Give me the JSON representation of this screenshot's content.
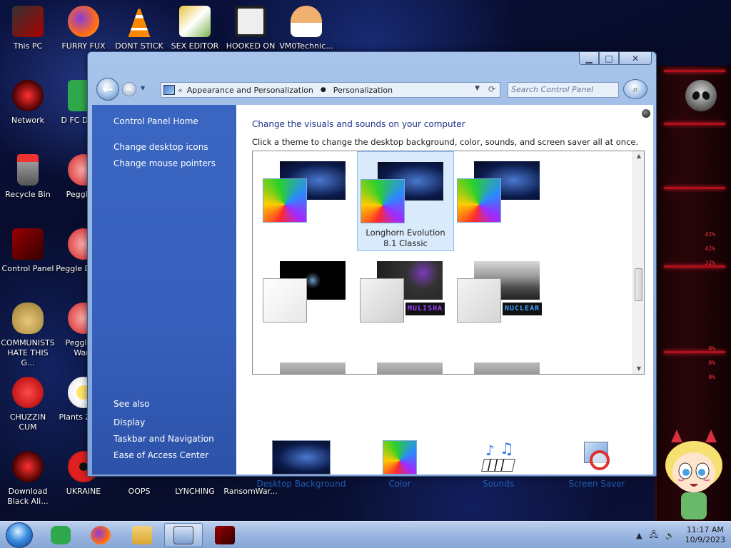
{
  "desktop": {
    "icons": [
      {
        "label": "This PC"
      },
      {
        "label": "FURRY FUX"
      },
      {
        "label": "DONT STICK"
      },
      {
        "label": "SEX EDITOR"
      },
      {
        "label": "HOOKED ON"
      },
      {
        "label": "VM0Technic..."
      },
      {
        "label": "Network"
      },
      {
        "label": "D FC DUMB"
      },
      {
        "label": "Recycle Bin"
      },
      {
        "label": "Peggle D"
      },
      {
        "label": "Control Panel"
      },
      {
        "label": "Peggle D Delu"
      },
      {
        "label": "COMMUNISTS HATE THIS G..."
      },
      {
        "label": "Peggle of Warc"
      },
      {
        "label": "CHUZZIN CUM"
      },
      {
        "label": "Plants Zomb"
      },
      {
        "label": "Download Black Ali..."
      },
      {
        "label": "UKRAINE"
      },
      {
        "label": "OOPS"
      },
      {
        "label": "LYNCHING"
      },
      {
        "label": "RansomWar..."
      }
    ],
    "wallpaper_percentages": [
      "42%",
      "42%",
      "32%",
      "0%",
      "0%",
      "0%"
    ]
  },
  "window": {
    "controls": {
      "minimize": "▁",
      "maximize": "□",
      "close": "✕"
    },
    "address": {
      "crumb_prefix": "«",
      "crumb1": "Appearance and Personalization",
      "separator": "●",
      "crumb2": "Personalization"
    },
    "search_placeholder": "Search Control Panel",
    "sidebar": {
      "home": "Control Panel Home",
      "links": [
        "Change desktop icons",
        "Change mouse pointers"
      ],
      "see_also_title": "See also",
      "see_also": [
        "Display",
        "Taskbar and Navigation",
        "Ease of Access Center"
      ]
    },
    "content": {
      "title": "Change the visuals and sounds on your computer",
      "subtitle": "Click a theme to change the desktop background, color, sounds, and screen saver all at once.",
      "selected_theme": {
        "name_line1": "Longhorn Evolution",
        "name_line2": "8.1 Classic"
      },
      "theme_tags": {
        "mulisha": "MULISHA",
        "nuclear": "NUCLEAR"
      },
      "options": [
        {
          "label": "Desktop Background"
        },
        {
          "label": "Color"
        },
        {
          "label": "Sounds"
        },
        {
          "label": "Screen Saver"
        }
      ]
    }
  },
  "taskbar": {
    "clock_time": "11:17 AM",
    "clock_date": "10/9/2023"
  },
  "colors": {
    "sidebar_blue": "#3a66c2",
    "link_blue": "#1f5cb0",
    "title_blue": "#1e3287",
    "selection": "#d9eafb"
  }
}
